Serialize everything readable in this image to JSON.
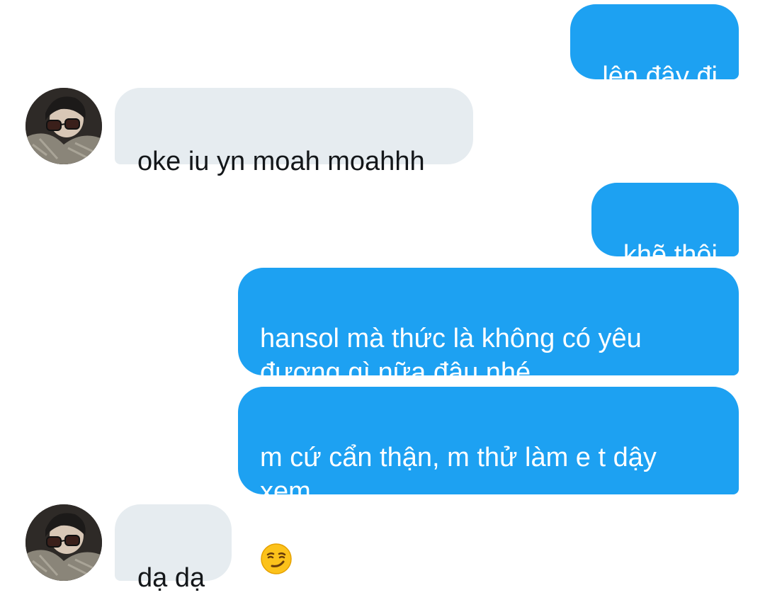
{
  "conversation": {
    "messages": [
      {
        "sender": "me",
        "text": "lên đây đi"
      },
      {
        "sender": "other",
        "text": "oke iu yn moah moahhh"
      },
      {
        "sender": "me",
        "text": "khẽ thôi"
      },
      {
        "sender": "me",
        "text": "hansol mà thức là không có yêu\nđương gì nữa đâu nhé"
      },
      {
        "sender": "me",
        "text": "m cứ cẩn thận, m thử làm e t dậy\nxem",
        "emoji": "smirking-face"
      },
      {
        "sender": "other",
        "text": "dạ dạ"
      }
    ]
  },
  "colors": {
    "sent_bubble": "#1da1f2",
    "sent_text": "#ffffff",
    "received_bubble": "#e6ecf0",
    "received_text": "#14171a",
    "background": "#ffffff"
  }
}
